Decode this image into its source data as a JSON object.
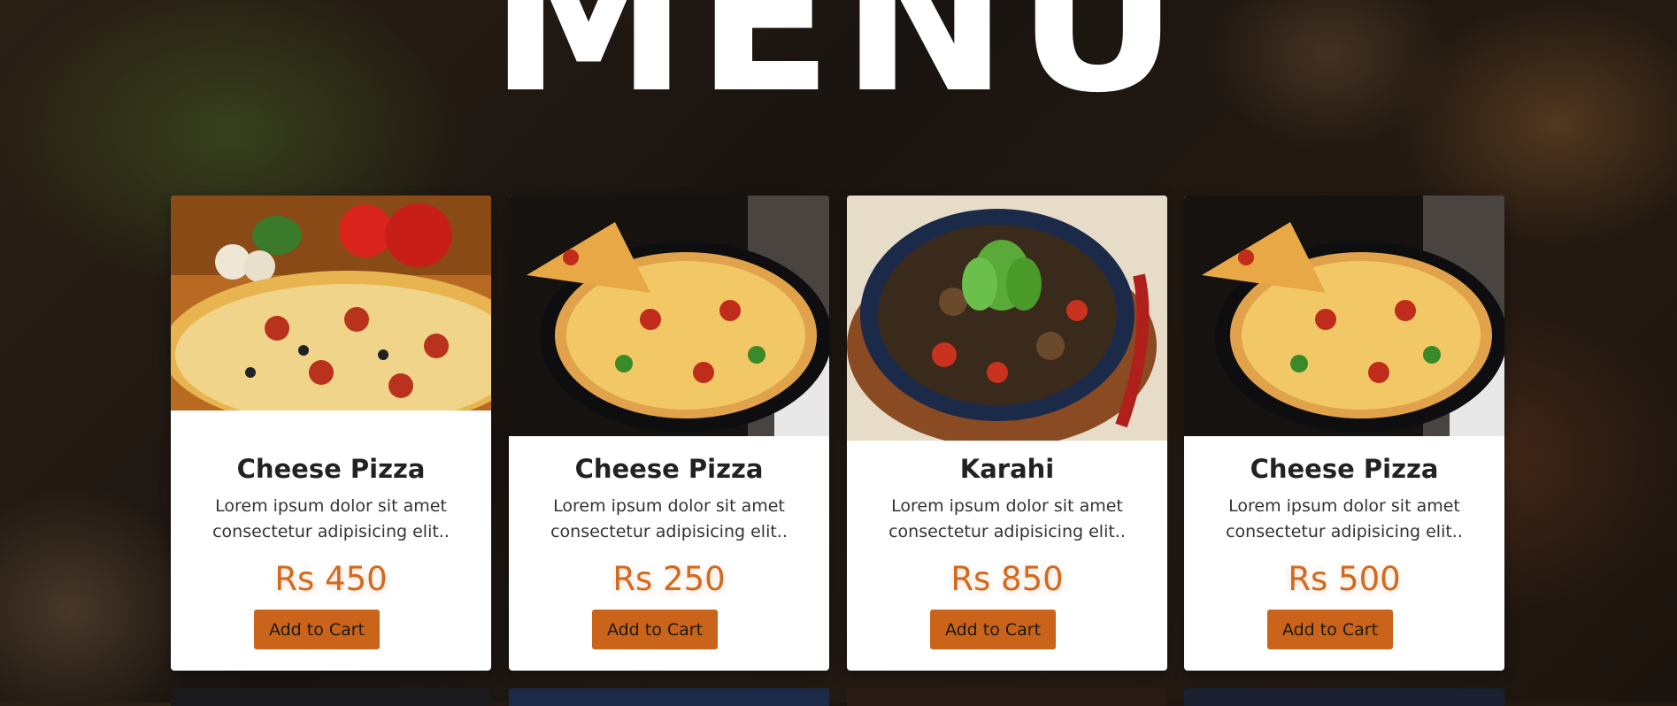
{
  "hero": {
    "title": "MENU"
  },
  "colors": {
    "accent": "#d2691e",
    "button": "#c9641a"
  },
  "menu_items": [
    {
      "name": "Cheese Pizza",
      "description": "Lorem ipsum dolor sit amet consectetur adipisicing elit..",
      "price": "Rs 450",
      "cta": "Add to Cart"
    },
    {
      "name": "Cheese Pizza",
      "description": "Lorem ipsum dolor sit amet consectetur adipisicing elit..",
      "price": "Rs 250",
      "cta": "Add to Cart"
    },
    {
      "name": "Karahi",
      "description": "Lorem ipsum dolor sit amet consectetur adipisicing elit..",
      "price": "Rs 850",
      "cta": "Add to Cart"
    },
    {
      "name": "Cheese Pizza",
      "description": "Lorem ipsum dolor sit amet consectetur adipisicing elit..",
      "price": "Rs 500",
      "cta": "Add to Cart"
    }
  ]
}
